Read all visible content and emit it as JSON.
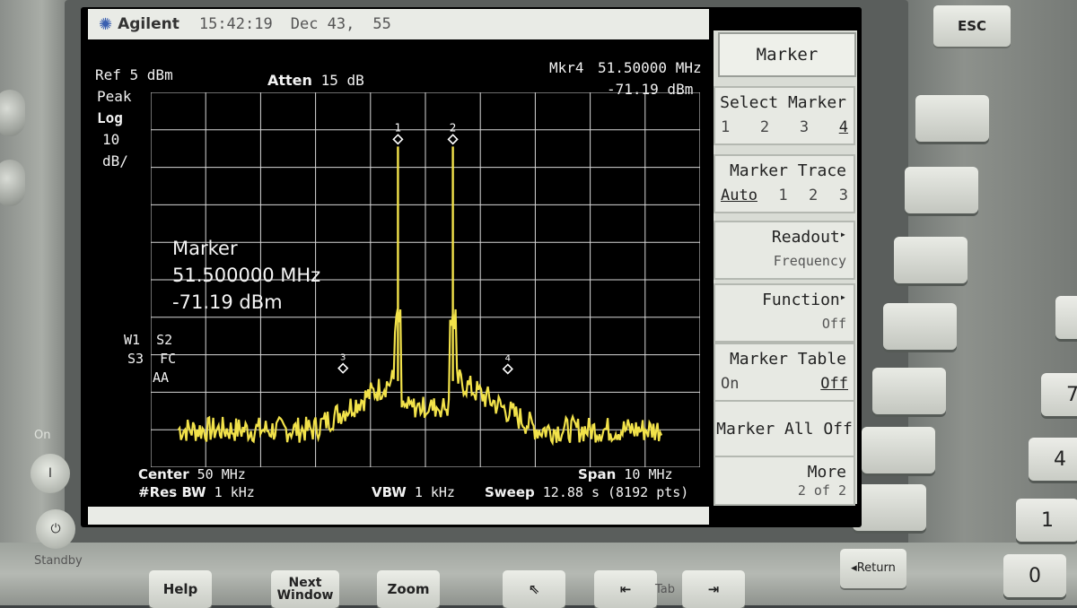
{
  "header": {
    "brand": "Agilent",
    "time": "15:42:19",
    "date": "Dec 43,",
    "extra": "55"
  },
  "settings": {
    "ref": "Ref 5 dBm",
    "atten_label": "Atten",
    "atten_value": "15 dB",
    "detector": "Peak",
    "scale_type": "Log",
    "scale_per_div": "10",
    "scale_unit": "dB/",
    "flags_1": "W1  S2",
    "flags_2": "S3  FC",
    "flags_3": "AA"
  },
  "marker_readout": {
    "top_label": "Mkr4",
    "top_freq": "51.50000 MHz",
    "top_level": "-71.19 dBm",
    "big_label": "Marker",
    "big_freq": "51.500000 MHz",
    "big_level": "-71.19 dBm"
  },
  "markers": [
    {
      "id": "1",
      "freq_mhz": 49.5,
      "level_dbm": -8
    },
    {
      "id": "2",
      "freq_mhz": 50.5,
      "level_dbm": -8
    },
    {
      "id": "3",
      "freq_mhz": 48.5,
      "level_dbm": -71
    },
    {
      "id": "4",
      "freq_mhz": 51.5,
      "level_dbm": -71.19
    }
  ],
  "footer": {
    "center_label": "Center",
    "center_value": "50 MHz",
    "span_label": "Span",
    "span_value": "10 MHz",
    "rbw_label": "#Res BW",
    "rbw_value": "1 kHz",
    "vbw_label": "VBW",
    "vbw_value": "1 kHz",
    "sweep_label": "Sweep",
    "sweep_value": "12.88 s (8192 pts)"
  },
  "menu": {
    "title": "Marker",
    "select_marker": {
      "label": "Select Marker",
      "options": [
        "1",
        "2",
        "3",
        "4"
      ],
      "selected": "4"
    },
    "marker_trace": {
      "label": "Marker Trace",
      "options": [
        "Auto",
        "1",
        "2",
        "3"
      ],
      "selected": "Auto"
    },
    "readout": {
      "label": "Readout",
      "value": "Frequency"
    },
    "function": {
      "label": "Function",
      "value": "Off"
    },
    "marker_table": {
      "label": "Marker Table",
      "on": "On",
      "off": "Off",
      "selected": "Off"
    },
    "marker_all_off": {
      "label": "Marker All Off"
    },
    "more": {
      "label": "More",
      "value": "2 of 2"
    }
  },
  "hardware": {
    "esc": "ESC",
    "return": "Return",
    "help": "Help",
    "next_window": "Next Window",
    "zoom": "Zoom",
    "tab": "Tab",
    "on": "On",
    "standby": "Standby",
    "power_on_symbol": "I",
    "standby_symbol": "⏻",
    "num_keys": [
      "7",
      "4",
      "1",
      "0"
    ]
  },
  "colors": {
    "trace": "#f2e24a",
    "grid": "#d8d8d8",
    "screen_bg": "#000000",
    "softkey_bg": "#e7e9e3"
  }
}
